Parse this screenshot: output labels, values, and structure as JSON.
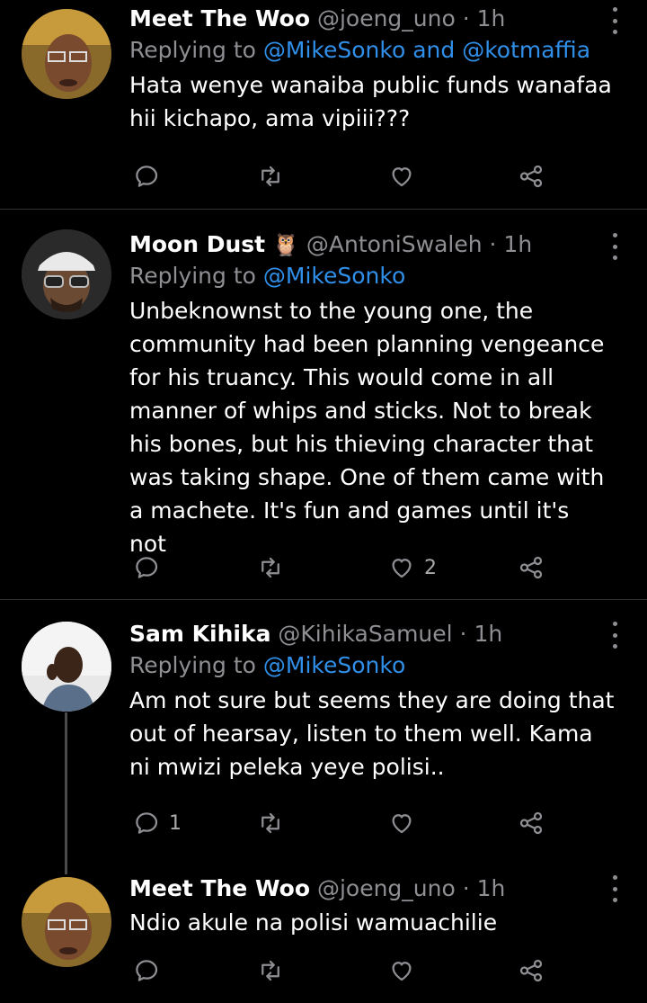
{
  "tweets": [
    {
      "name": "Meet The Woo",
      "handle": "@joeng_uno",
      "sep": " · ",
      "time": "1h",
      "replying_prefix": "Replying to ",
      "replying_to": "@MikeSonko and @kotmaffia",
      "text": "Hata wenye wanaiba public funds wanafaa hii kichapo, ama vipiii???",
      "reply_count": "",
      "retweet_count": "",
      "like_count": ""
    },
    {
      "name": "Moon Dust",
      "name_emoji": "🦉",
      "handle": "@AntoniSwaleh",
      "sep": " · ",
      "time": "1h",
      "replying_prefix": "Replying to ",
      "replying_to": "@MikeSonko",
      "text": "Unbeknownst to the young one, the community had been planning vengeance for his truancy. This would come in all manner of whips and sticks. Not to break his bones, but his thieving character that was taking shape. One of them came with a machete. It's fun and games until it's not",
      "reply_count": "",
      "retweet_count": "",
      "like_count": "2"
    },
    {
      "name": "Sam Kihika",
      "handle": "@KihikaSamuel",
      "sep": " · ",
      "time": "1h",
      "replying_prefix": "Replying to ",
      "replying_to": "@MikeSonko",
      "text": "Am not sure but seems they are doing that out of hearsay, listen to them well. Kama ni mwizi peleka yeye polisi..",
      "reply_count": "1",
      "retweet_count": "",
      "like_count": ""
    },
    {
      "name": "Meet The Woo",
      "handle": "@joeng_uno",
      "sep": " · ",
      "time": "1h",
      "text": "Ndio akule na polisi wamuachilie",
      "reply_count": "",
      "retweet_count": "",
      "like_count": ""
    }
  ],
  "icons": {
    "reply": "reply-icon",
    "retweet": "retweet-icon",
    "like": "heart-icon",
    "share": "share-icon",
    "more": "more-options-icon"
  },
  "colors": {
    "background": "#000000",
    "name": "#ffffff",
    "meta": "#8e8e93",
    "mention": "#2f8fe9",
    "divider": "#2f3336"
  }
}
